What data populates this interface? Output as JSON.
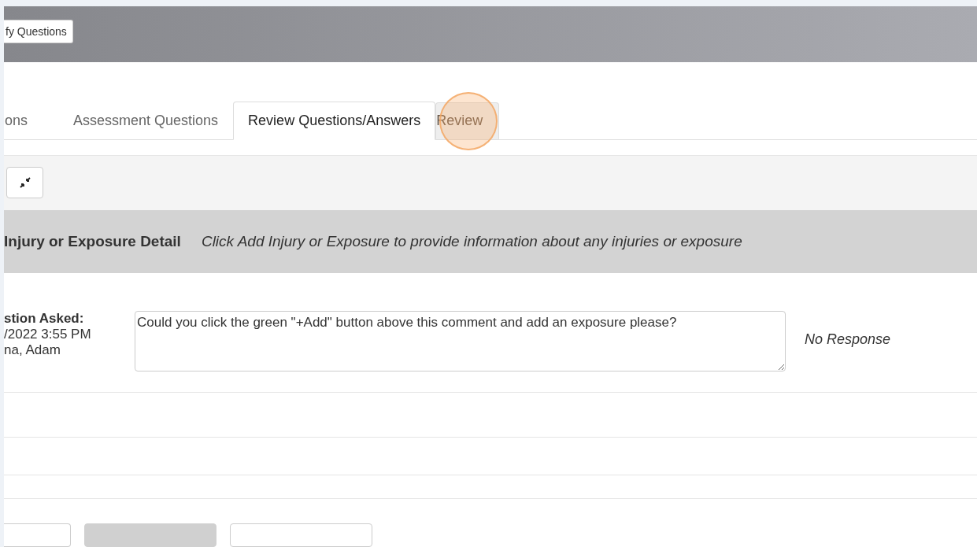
{
  "header": {
    "button": "fy Questions"
  },
  "tabs": [
    {
      "label": "ons",
      "selected": false,
      "disabled": false
    },
    {
      "label": "Assessment Questions",
      "selected": false,
      "disabled": false
    },
    {
      "label": "Review Questions/Answers",
      "selected": true,
      "disabled": false
    },
    {
      "label": "Review",
      "selected": false,
      "disabled": true
    }
  ],
  "section": {
    "title": "Injury or Exposure Detail",
    "hint": "Click Add Injury or Exposure to provide information about any injuries or exposure"
  },
  "question": {
    "label": "stion Asked:",
    "date": "/2022 3:55 PM",
    "author": "na, Adam",
    "comment": "Could you click the green \"+Add\" button above this comment and add an exposure please?",
    "response": "No Response"
  },
  "footer_buttons": [
    {
      "disabled": false
    },
    {
      "disabled": true
    },
    {
      "disabled": false
    }
  ]
}
